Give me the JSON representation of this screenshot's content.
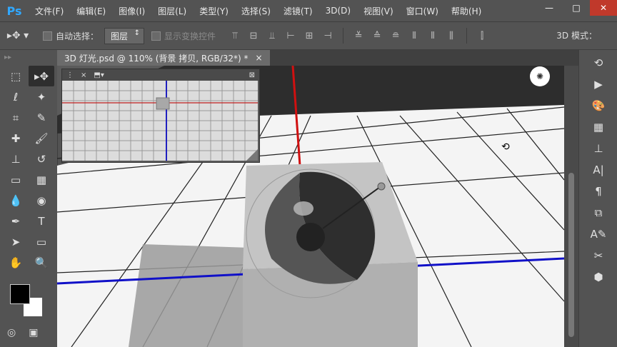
{
  "app": {
    "logo": "Ps"
  },
  "menu": [
    "文件(F)",
    "编辑(E)",
    "图像(I)",
    "图层(L)",
    "类型(Y)",
    "选择(S)",
    "滤镜(T)",
    "3D(D)",
    "视图(V)",
    "窗口(W)",
    "帮助(H)"
  ],
  "window_controls": {
    "minimize": "—",
    "restore": "□",
    "close": "✕"
  },
  "options_bar": {
    "auto_select_label": "自动选择：",
    "auto_select_value": "图层",
    "show_transform_label": "显示变换控件",
    "mode_3d_label": "3D 模式："
  },
  "document_tab": {
    "title": "3D 灯光.psd @ 110% (背景 拷贝, RGB/32*) *",
    "close": "×"
  },
  "tools": [
    "move-tool",
    "marquee-tool",
    "lasso-tool",
    "magic-wand-tool",
    "crop-tool",
    "eyedropper-tool",
    "healing-brush-tool",
    "brush-tool",
    "clone-stamp-tool",
    "history-brush-tool",
    "eraser-tool",
    "gradient-tool",
    "blur-tool",
    "dodge-tool",
    "pen-tool",
    "type-tool",
    "path-selection-tool",
    "rectangle-tool",
    "hand-tool",
    "zoom-tool"
  ],
  "colors": {
    "foreground": "#000000",
    "background": "#ffffff",
    "x_axis": "#0000cc",
    "y_axis": "#cc0000"
  },
  "right_panel_icons": [
    "history-icon",
    "play-icon",
    "color-palette-icon",
    "swatches-icon",
    "layer-icon",
    "character-icon",
    "paragraph-icon",
    "clone-source-icon",
    "brush-preset-icon",
    "tools-preset-icon",
    "3d-icon"
  ]
}
